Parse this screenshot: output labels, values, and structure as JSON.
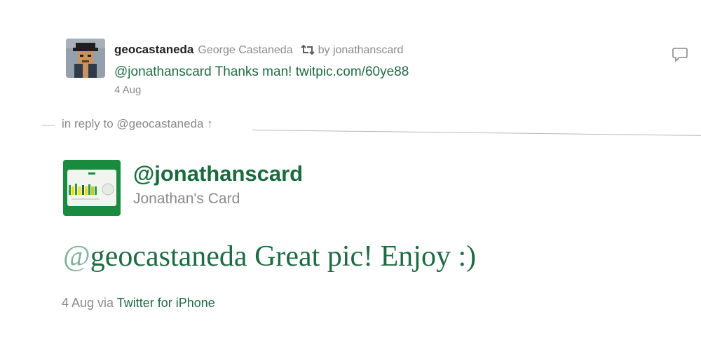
{
  "retweeted_tweet": {
    "screen_name": "geocastaneda",
    "full_name": "George Castaneda",
    "retweet_icon": "retweet-icon",
    "retweeted_by": "by jonathanscard",
    "text_mention": "@jonathanscard",
    "text_body": " Thanks man! ",
    "text_link": "twitpic.com/60ye88",
    "date": "4 Aug",
    "reply_icon": "speech-bubble-icon"
  },
  "reply_context": {
    "text": "in reply to @geocastaneda ↑"
  },
  "main_tweet": {
    "screen_name": "@jonathanscard",
    "full_name": "Jonathan's Card",
    "text_at": "@",
    "text_mention": "geocastaneda",
    "text_body": " Great pic! Enjoy :)",
    "date": "4 Aug",
    "via": " via ",
    "source": "Twitter for iPhone"
  },
  "colors": {
    "link_green": "#1f6b43",
    "brand_green": "#1a8a3e",
    "muted_gray": "#8a8a8a"
  }
}
